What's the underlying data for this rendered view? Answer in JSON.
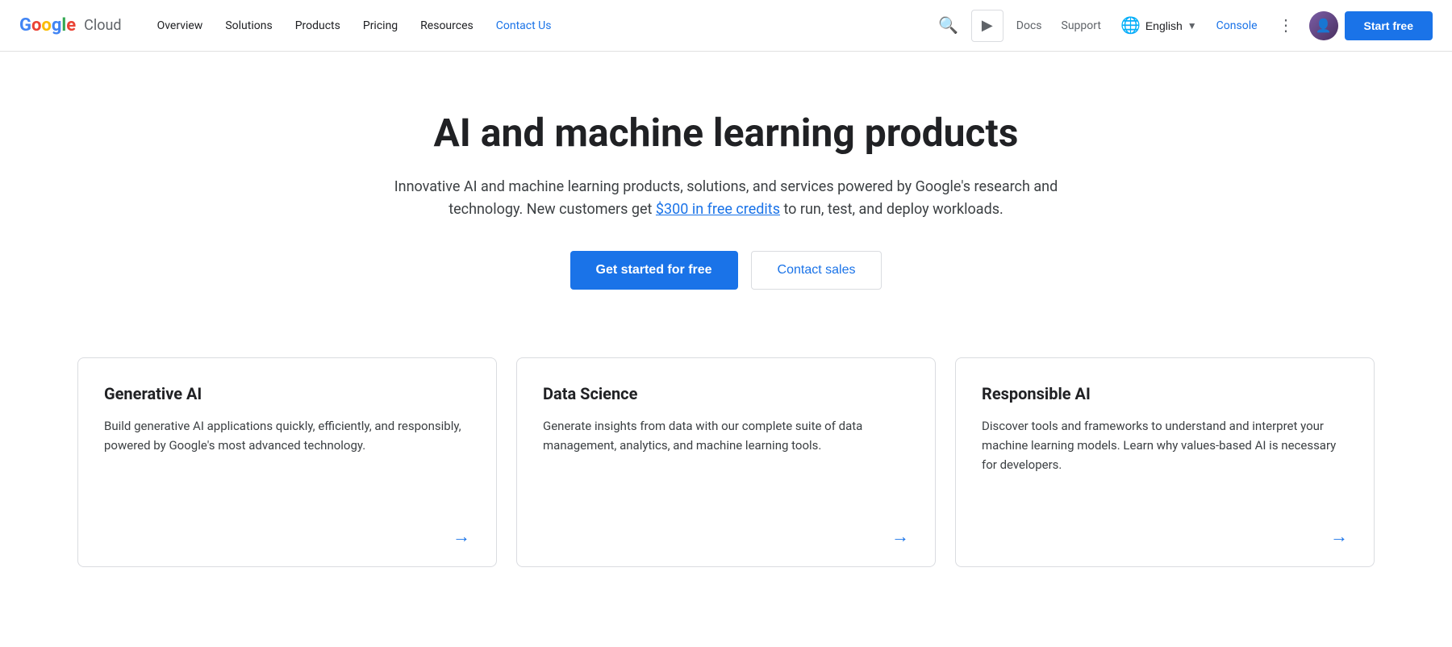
{
  "nav": {
    "logo_google": "Google",
    "logo_cloud": "Cloud",
    "links": [
      {
        "label": "Overview",
        "active": false
      },
      {
        "label": "Solutions",
        "active": false
      },
      {
        "label": "Products",
        "active": false
      },
      {
        "label": "Pricing",
        "active": false
      },
      {
        "label": "Resources",
        "active": false
      },
      {
        "label": "Contact Us",
        "active": true
      }
    ],
    "docs_label": "Docs",
    "support_label": "Support",
    "language_label": "English",
    "console_label": "Console",
    "start_free_label": "Start free"
  },
  "hero": {
    "title": "AI and machine learning products",
    "description_before": "Innovative AI and machine learning products, solutions, and services powered by Google's research and technology. New customers get ",
    "credits_link": "$300 in free credits",
    "description_after": " to run, test, and deploy workloads.",
    "cta_primary": "Get started for free",
    "cta_secondary": "Contact sales"
  },
  "cards": [
    {
      "title": "Generative AI",
      "description": "Build generative AI applications quickly, efficiently, and responsibly, powered by Google's most advanced technology.",
      "arrow": "→"
    },
    {
      "title": "Data Science",
      "description": "Generate insights from data with our complete suite of data management, analytics, and machine learning tools.",
      "arrow": "→"
    },
    {
      "title": "Responsible AI",
      "description": "Discover tools and frameworks to understand and interpret your machine learning models. Learn why values-based AI is necessary for developers.",
      "arrow": "→"
    }
  ]
}
